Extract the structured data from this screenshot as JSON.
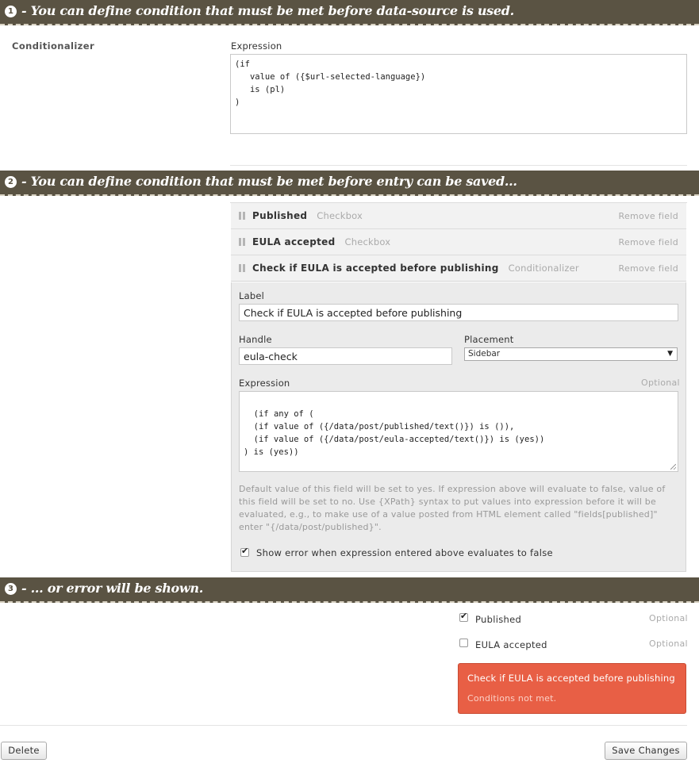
{
  "banners": [
    {
      "num": "1",
      "text": "- You can define condition that must be met before data-source is used."
    },
    {
      "num": "2",
      "text": "- You can define condition that must be met before entry can be saved..."
    },
    {
      "num": "3",
      "text": "- ... or error will be shown."
    }
  ],
  "section1": {
    "name": "Conditionalizer",
    "expression_label": "Expression",
    "expression_value": "(if\n   value of ({$url-selected-language})\n   is (pl)\n)"
  },
  "section2": {
    "fields": [
      {
        "name": "Published",
        "type": "Checkbox",
        "remove": "Remove field"
      },
      {
        "name": "EULA accepted",
        "type": "Checkbox",
        "remove": "Remove field"
      },
      {
        "name": "Check if EULA is accepted before publishing",
        "type": "Conditionalizer",
        "remove": "Remove field"
      }
    ],
    "label_label": "Label",
    "label_value": "Check if EULA is accepted before publishing",
    "handle_label": "Handle",
    "handle_value": "eula-check",
    "placement_label": "Placement",
    "placement_value": "Sidebar",
    "expression_label": "Expression",
    "expression_optional": "Optional",
    "expression_value": "(if any of (\n  (if value of ({/data/post/published/text()}) is ()),\n  (if value of ({/data/post/eula-accepted/text()}) is (yes))\n) is (yes))",
    "help_text": "Default value of this field will be set to yes. If expression above will evaluate to false, value of this field will be set to no. Use {XPath} syntax to put values into expression before it will be evaluated, e.g., to make use of a value posted from HTML element called \"fields[published]\" enter \"{/data/post/published}\".",
    "show_error_label": "Show error when expression entered above evaluates to false",
    "show_error_checked": true
  },
  "section3": {
    "published_label": "Published",
    "published_checked": true,
    "published_optional": "Optional",
    "eula_label": "EULA accepted",
    "eula_checked": false,
    "eula_optional": "Optional",
    "error_title": "Check if EULA is accepted before publishing",
    "error_message": "Conditions not met.",
    "error_color": "#e85f45"
  },
  "actions": {
    "delete_label": "Delete",
    "save_label": "Save Changes"
  },
  "colors": {
    "banner_bg": "#5a5343"
  }
}
